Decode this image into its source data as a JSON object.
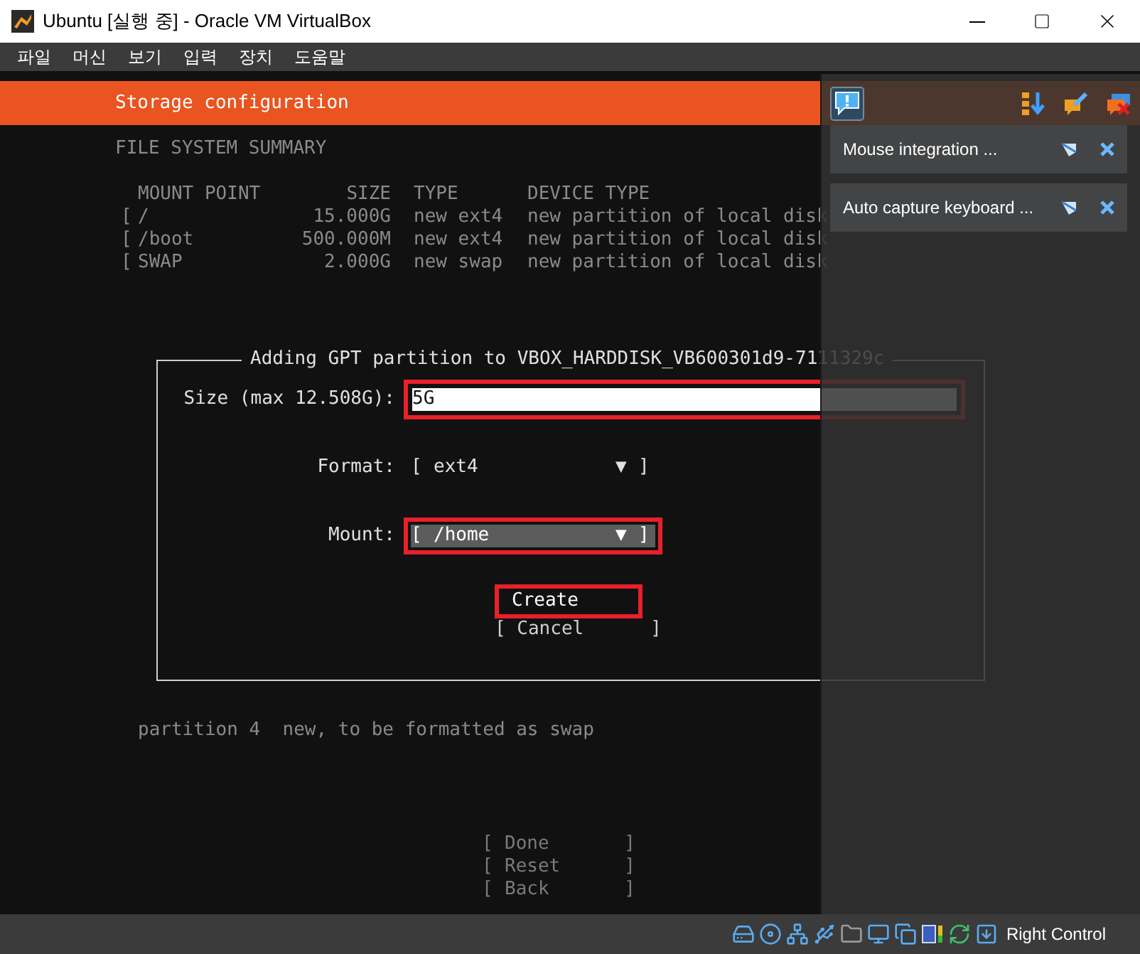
{
  "window": {
    "title": "Ubuntu [실행 중] - Oracle VM VirtualBox"
  },
  "menu": [
    "파일",
    "머신",
    "보기",
    "입력",
    "장치",
    "도움말"
  ],
  "installer": {
    "header": "Storage configuration",
    "summary_title": "FILE SYSTEM SUMMARY",
    "table": {
      "columns": [
        "MOUNT POINT",
        "SIZE",
        "TYPE",
        "DEVICE TYPE"
      ],
      "rows": [
        {
          "bracket": "[",
          "mount": "/",
          "size": "15.000G",
          "type": "new ext4",
          "device": "new partition of local disk"
        },
        {
          "bracket": "[",
          "mount": "/boot",
          "size": "500.000M",
          "type": "new ext4",
          "device": "new partition of local disk"
        },
        {
          "bracket": "[",
          "mount": "SWAP",
          "size": "2.000G",
          "type": "new swap",
          "device": "new partition of local disk"
        }
      ]
    },
    "dialog": {
      "title": "Adding GPT partition to VBOX_HARDDISK_VB600301d9-7111329c",
      "fields": [
        {
          "kind": "input",
          "label": "Size (max 12.508G):",
          "value": "5G",
          "highlighted": true
        },
        {
          "kind": "dropdown",
          "label": "Format:",
          "value": "ext4",
          "arrow": "▼",
          "open": "[",
          "close": "]",
          "selected": false,
          "highlighted": false
        },
        {
          "kind": "dropdown",
          "label": "Mount:",
          "value": "/home",
          "arrow": "▼",
          "open": "[",
          "close": "]",
          "selected": true,
          "highlighted": true
        }
      ],
      "buttons": [
        {
          "label": "Create",
          "selected": true,
          "highlighted": true
        },
        {
          "label": "[ Cancel      ]",
          "selected": false,
          "highlighted": false
        }
      ]
    },
    "partition_line": "partition 4  new, to be formatted as swap",
    "actions": [
      {
        "open": "[",
        "label": "Done",
        "close": "]",
        "disabled": true
      },
      {
        "open": "[",
        "label": "Reset",
        "close": "]",
        "disabled": true
      },
      {
        "open": "[",
        "label": "Back",
        "close": "]",
        "disabled": true
      }
    ]
  },
  "notifications": [
    {
      "text": "Mouse integration ..."
    },
    {
      "text": "Auto capture keyboard ..."
    }
  ],
  "status_bar": {
    "host_key": "Right Control"
  }
}
